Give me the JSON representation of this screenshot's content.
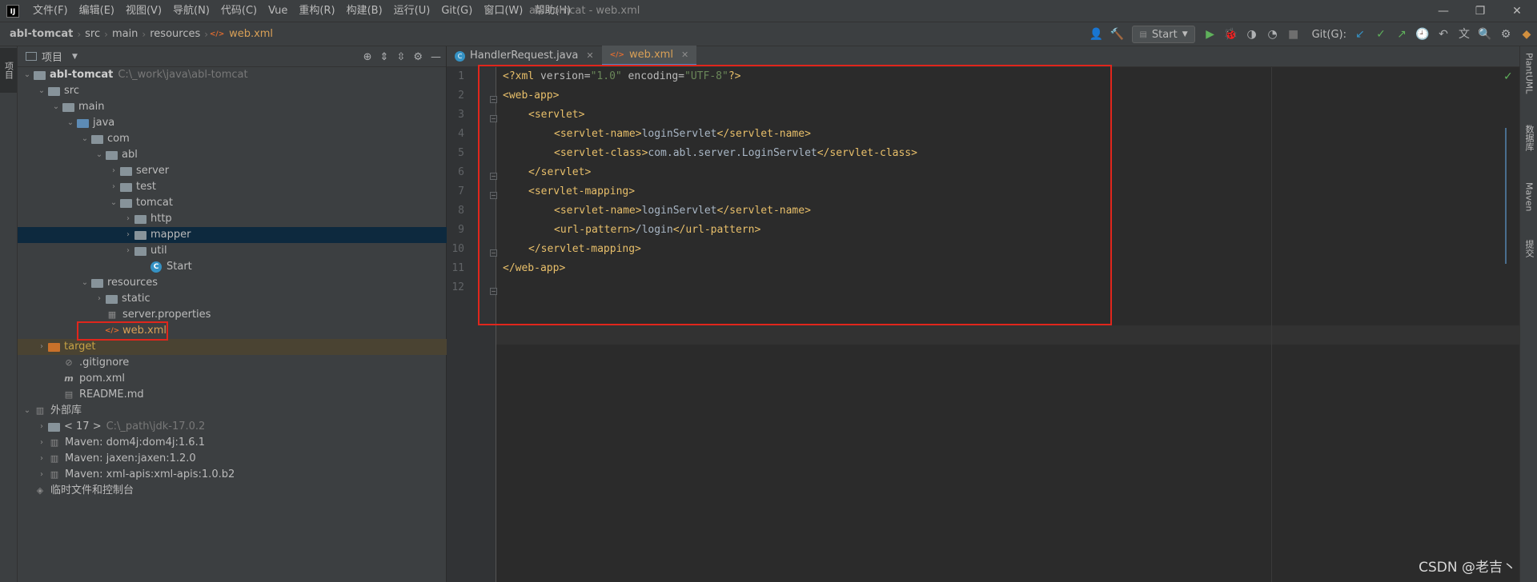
{
  "app": {
    "logo": "IJ",
    "window_title": "abl-tomcat - web.xml"
  },
  "menu": [
    "文件(F)",
    "编辑(E)",
    "视图(V)",
    "导航(N)",
    "代码(C)",
    "Vue",
    "重构(R)",
    "构建(B)",
    "运行(U)",
    "Git(G)",
    "窗口(W)",
    "帮助(H)"
  ],
  "window_controls": {
    "minimize": "—",
    "restore": "❐",
    "close": "✕"
  },
  "breadcrumb": [
    "abl-tomcat",
    "src",
    "main",
    "resources",
    "web.xml"
  ],
  "toolbar": {
    "run_config": "Start",
    "git_label": "Git(G):"
  },
  "left_stripe": {
    "project_tab": "项目"
  },
  "project_panel": {
    "title": "项目"
  },
  "tree": [
    {
      "label": "abl-tomcat",
      "path": "C:\\_work\\java\\abl-tomcat"
    },
    {
      "label": "src"
    },
    {
      "label": "main"
    },
    {
      "label": "java"
    },
    {
      "label": "com"
    },
    {
      "label": "abl"
    },
    {
      "label": "server"
    },
    {
      "label": "test"
    },
    {
      "label": "tomcat"
    },
    {
      "label": "http"
    },
    {
      "label": "mapper"
    },
    {
      "label": "util"
    },
    {
      "label": "Start"
    },
    {
      "label": "resources"
    },
    {
      "label": "static"
    },
    {
      "label": "server.properties"
    },
    {
      "label": "web.xml"
    },
    {
      "label": "target"
    },
    {
      "label": ".gitignore"
    },
    {
      "label": "pom.xml"
    },
    {
      "label": "README.md"
    },
    {
      "label": "外部库"
    },
    {
      "label": "< 17 >",
      "path": "C:\\_path\\jdk-17.0.2"
    },
    {
      "label": "Maven: dom4j:dom4j:1.6.1"
    },
    {
      "label": "Maven: jaxen:jaxen:1.2.0"
    },
    {
      "label": "Maven: xml-apis:xml-apis:1.0.b2"
    },
    {
      "label": "临时文件和控制台"
    }
  ],
  "tabs": [
    "HandlerRequest.java",
    "web.xml"
  ],
  "line_numbers": [
    "1",
    "2",
    "3",
    "4",
    "5",
    "6",
    "7",
    "8",
    "9",
    "10",
    "11",
    "12"
  ],
  "code": {
    "l1_pi_open": "<?xml",
    "l1_attr1": " version=",
    "l1_val1": "\"1.0\"",
    "l1_attr2": " encoding=",
    "l1_val2": "\"UTF-8\"",
    "l1_pi_close": "?>",
    "l2": "<web-app>",
    "l3": "<servlet>",
    "l4_open": "<servlet-name>",
    "l4_text": "loginServlet",
    "l4_close": "</servlet-name>",
    "l5_open": "<servlet-class>",
    "l5_text": "com.abl.server.LoginServlet",
    "l5_close": "</servlet-class>",
    "l6": "</servlet>",
    "l7": "<servlet-mapping>",
    "l8_open": "<servlet-name>",
    "l8_text": "loginServlet",
    "l8_close": "</servlet-name>",
    "l9_open": "<url-pattern>",
    "l9_text": "/login",
    "l9_close": "</url-pattern>",
    "l10": "</servlet-mapping>",
    "l11": "</web-app>"
  },
  "right_stripe": [
    "PlantUML",
    "数据库",
    "Maven",
    "提交"
  ],
  "watermark": "CSDN @老吉丶",
  "colors": {
    "accent": "#4a88c7",
    "highlight_box": "#e0261c",
    "selected_row": "#0d293e"
  }
}
